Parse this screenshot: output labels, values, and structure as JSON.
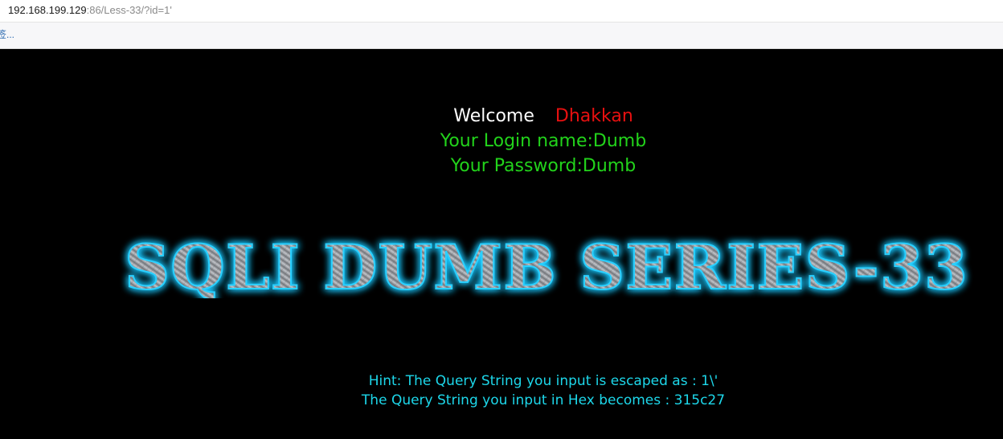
{
  "browser": {
    "url_host": "192.168.199.129",
    "url_rest": ":86/Less-33/?id=1'",
    "bookmark_label": "签..."
  },
  "page": {
    "welcome_label": "Welcome",
    "welcome_name": "Dhakkan",
    "login_line": "Your Login name:Dumb",
    "password_line": "Your Password:Dumb",
    "banner_title": "SQLI DUMB SERIES-33",
    "hint_escaped": "Hint: The Query String you input is escaped as : 1\\'",
    "hint_hex": "The Query String you input in Hex becomes : 315c27"
  },
  "colors": {
    "background": "#000000",
    "welcome_label": "#ffffff",
    "welcome_name": "#e81010",
    "credentials": "#22d31b",
    "hint": "#1dd7ea",
    "banner_glow": "#1ec8ff",
    "banner_fill": "#8c8f94"
  }
}
